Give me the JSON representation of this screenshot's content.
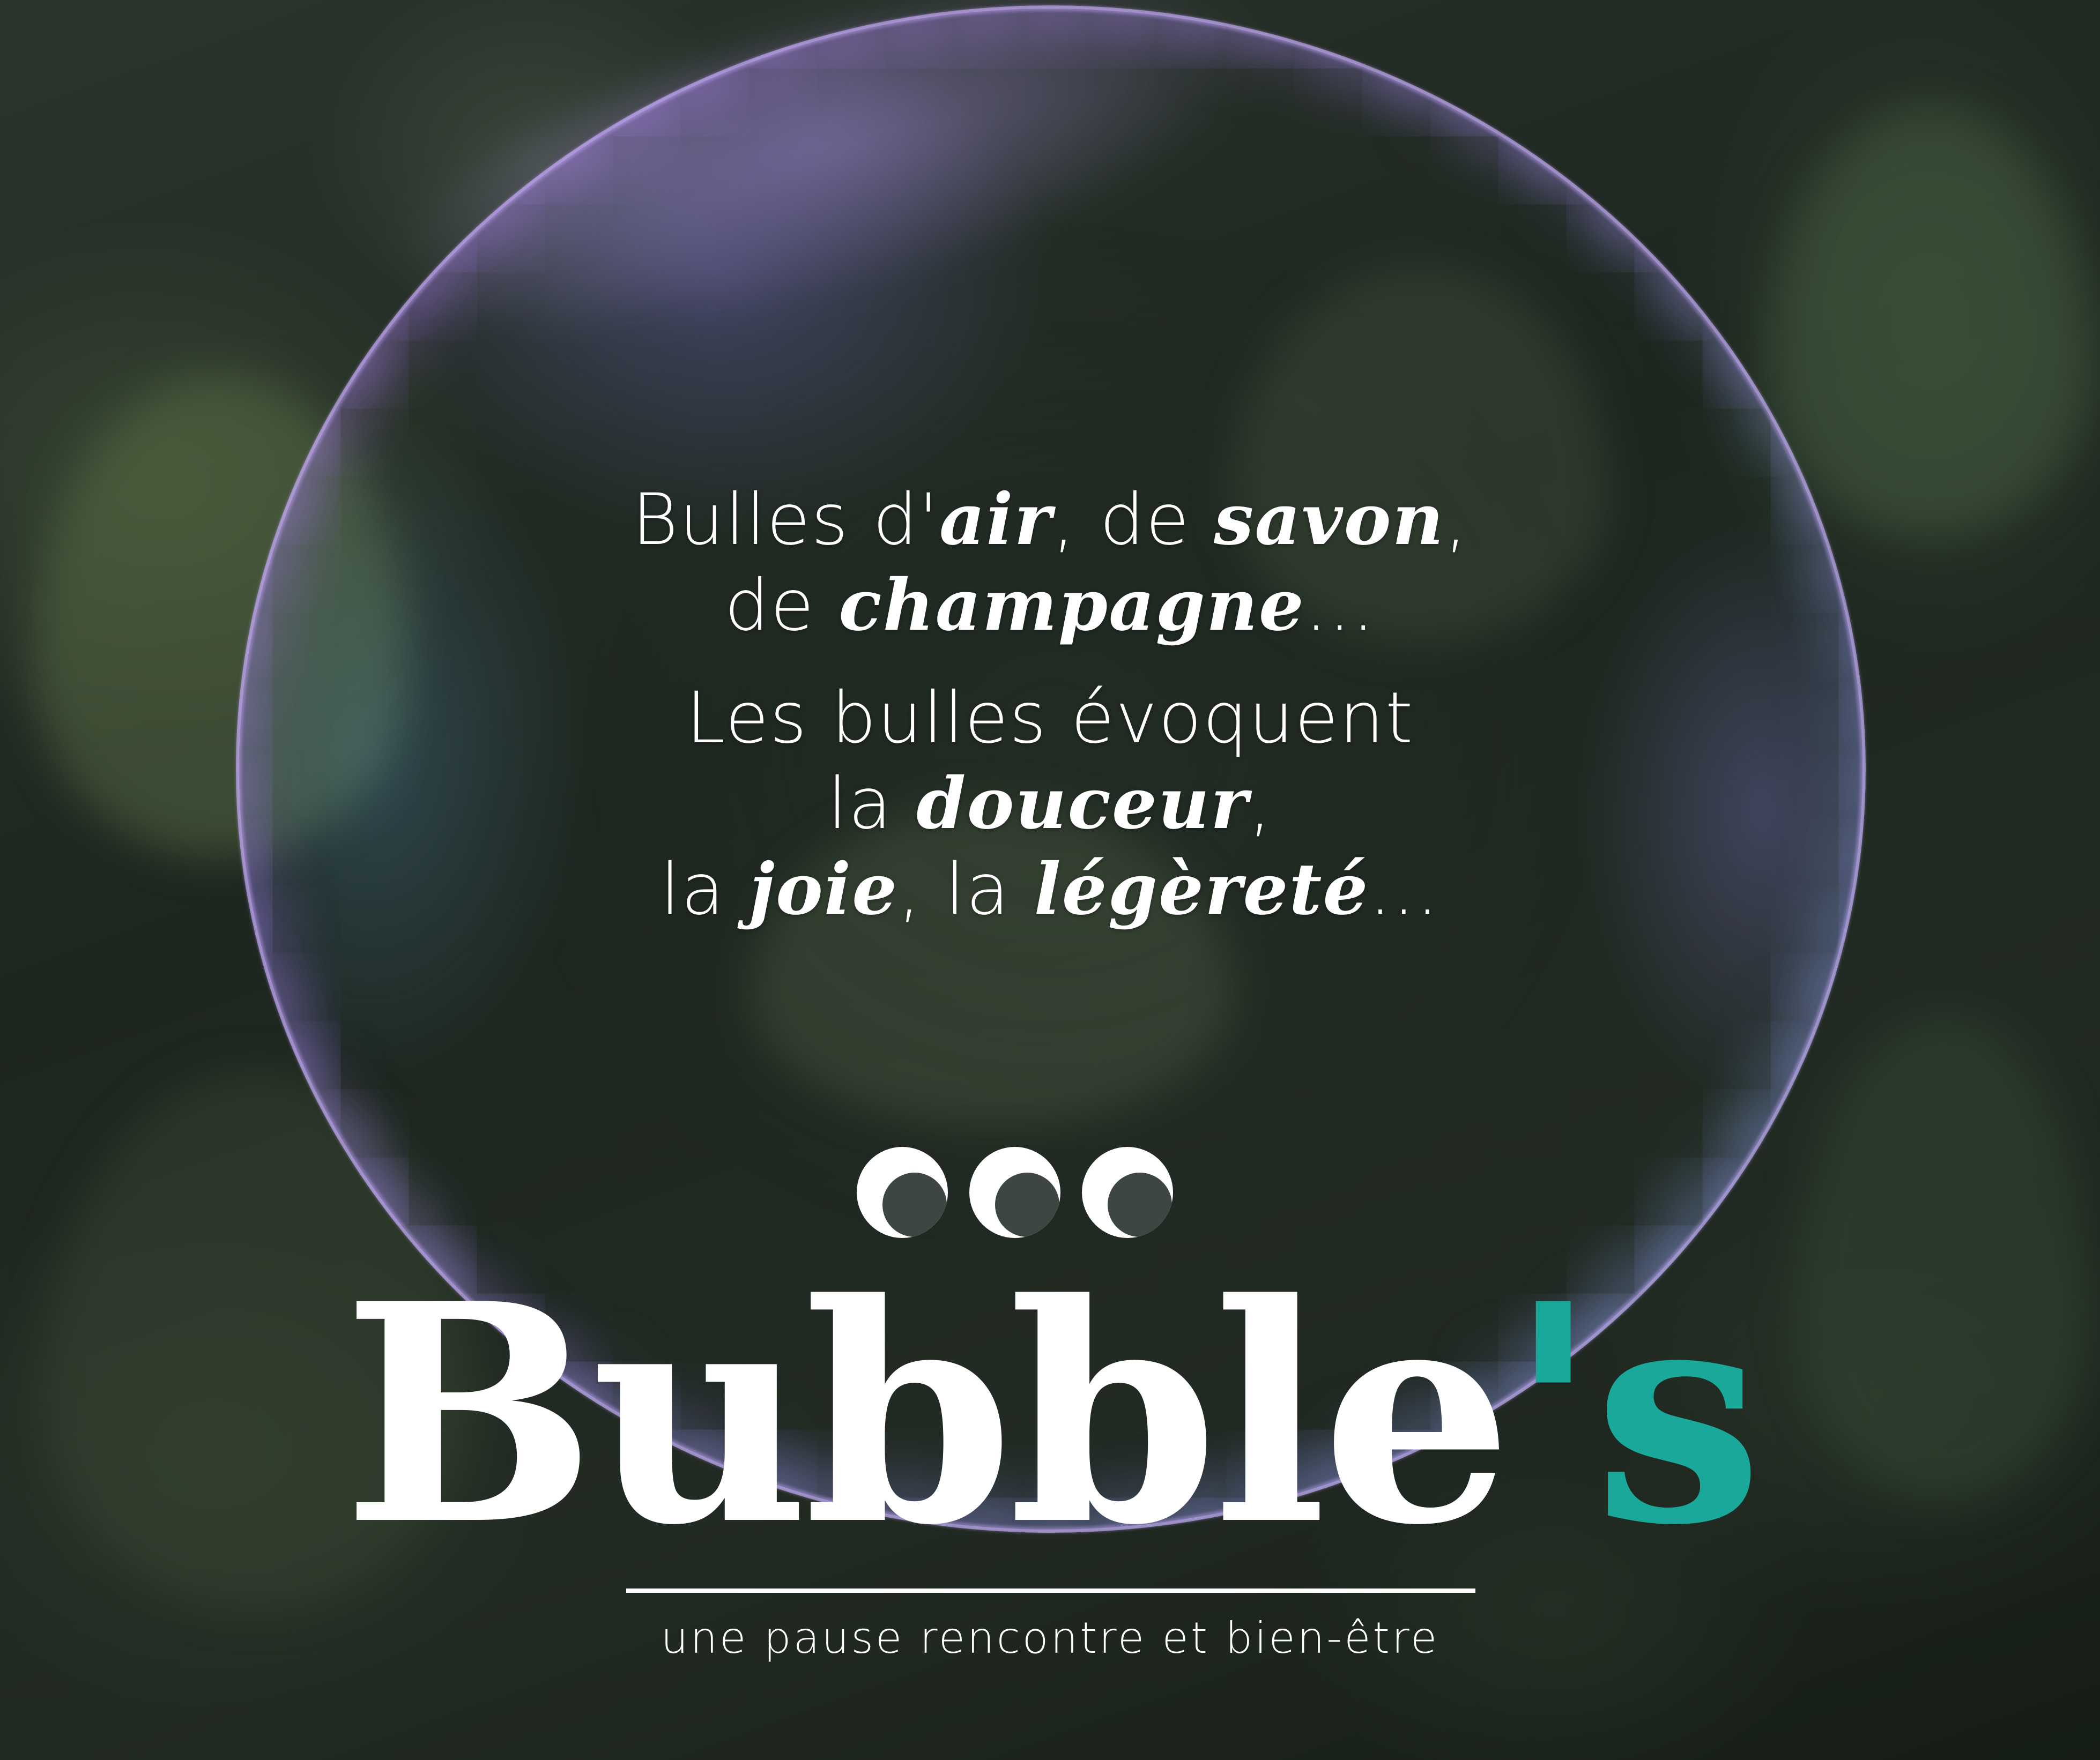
{
  "quote": {
    "line1": {
      "a": "Bulles d'",
      "b1": "air",
      "c": ", de ",
      "b2": "savon",
      "d": ","
    },
    "line2": {
      "a": "de ",
      "b1": "champagne",
      "c": "..."
    },
    "line3": {
      "a": "Les bulles évoquent"
    },
    "line4": {
      "a": "la ",
      "b1": "douceur",
      "c": ","
    },
    "line5": {
      "a": "la ",
      "b1": "joie",
      "c": ", la ",
      "b2": "légèreté",
      "d": "..."
    }
  },
  "logo": {
    "name_main": "Bubble",
    "name_apostrophe": "'",
    "name_suffix": "s",
    "accent_color": "#19a89a"
  },
  "tagline": "une pause rencontre et bien-être"
}
